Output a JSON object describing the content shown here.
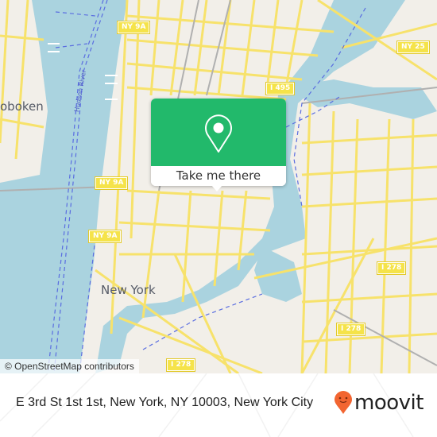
{
  "map": {
    "attribution": "© OpenStreetMap contributors",
    "place_labels": [
      {
        "name": "New York"
      },
      {
        "name": "Hoboken",
        "visible_text": "oboken"
      }
    ],
    "water_labels": [
      {
        "name": "Hudson River"
      }
    ],
    "road_shields": [
      {
        "label": "NY 9A"
      },
      {
        "label": "NY 9A"
      },
      {
        "label": "NY 9A"
      },
      {
        "label": "NY 25"
      },
      {
        "label": "I 495"
      },
      {
        "label": "I 278"
      },
      {
        "label": "I 278"
      },
      {
        "label": "I 278"
      }
    ],
    "colors": {
      "water": "#aad3df",
      "land": "#f2efe9",
      "road": "#f7e26b",
      "ferry": "#5a6de0"
    }
  },
  "popup": {
    "icon": "map-pin-icon",
    "button_label": "Take me there",
    "color": "#22b96b"
  },
  "footer": {
    "address": "E 3rd St 1st 1st, New York, NY 10003, New York City",
    "brand": "moovit",
    "brand_icon": "moovit-smiley-pin-icon",
    "brand_color": "#f26531"
  }
}
